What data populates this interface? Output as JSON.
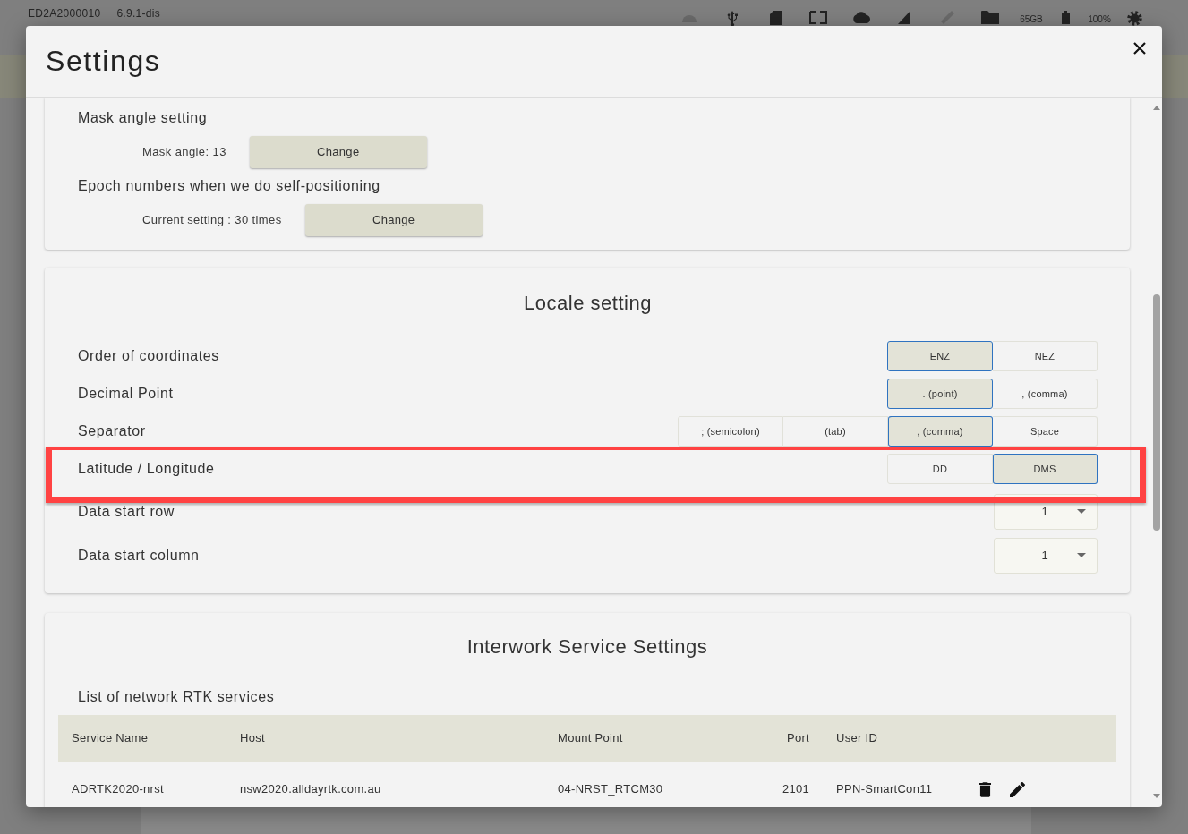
{
  "status_bar": {
    "device_id": "ED2A2000010",
    "version": "6.9.1-dis",
    "storage": "65GB",
    "battery": "100%"
  },
  "dialog": {
    "title": "Settings",
    "positioning_settings": [
      {
        "heading": "Mask angle setting",
        "current_value": "Mask angle: 13",
        "button": "Change"
      },
      {
        "heading": "Epoch numbers when we do self-positioning",
        "current_value": "Current setting : 30 times",
        "button": "Change"
      }
    ],
    "locale": {
      "title": "Locale setting",
      "rows": [
        {
          "label": "Order of coordinates",
          "kind": "toggle",
          "highlighted": false,
          "options": [
            {
              "label": "ENZ",
              "selected": true
            },
            {
              "label": "NEZ",
              "selected": false
            }
          ]
        },
        {
          "label": "Decimal Point",
          "kind": "toggle",
          "highlighted": false,
          "options": [
            {
              "label": ". (point)",
              "selected": true
            },
            {
              "label": ", (comma)",
              "selected": false
            }
          ]
        },
        {
          "label": "Separator",
          "kind": "toggle",
          "highlighted": false,
          "options": [
            {
              "label": "; (semicolon)",
              "selected": false
            },
            {
              "label": "(tab)",
              "selected": false
            },
            {
              "label": ", (comma)",
              "selected": true
            },
            {
              "label": "Space",
              "selected": false
            }
          ]
        },
        {
          "label": "Latitude / Longitude",
          "kind": "toggle",
          "highlighted": true,
          "options": [
            {
              "label": "DD",
              "selected": false
            },
            {
              "label": "DMS",
              "selected": true
            }
          ]
        },
        {
          "label": "Data start row",
          "kind": "select",
          "highlighted": false,
          "value": "1"
        },
        {
          "label": "Data start column",
          "kind": "select",
          "highlighted": false,
          "value": "1"
        }
      ]
    },
    "interwork": {
      "title": "Interwork Service Settings",
      "list_title": "List of network RTK services",
      "table": {
        "columns": [
          "Service Name",
          "Host",
          "Mount Point",
          "Port",
          "User ID"
        ],
        "rows": [
          {
            "cells": [
              "ADRTK2020-nrst",
              "nsw2020.alldayrtk.com.au",
              "04-NRST_RTCM30",
              "2101",
              "PPN-SmartCon11"
            ]
          }
        ]
      }
    }
  }
}
